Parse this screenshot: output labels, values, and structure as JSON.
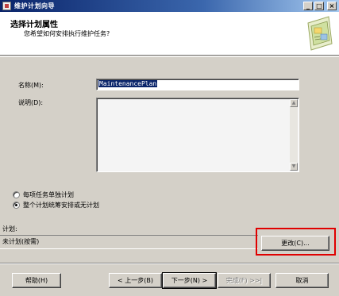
{
  "window": {
    "title": "维护计划向导"
  },
  "header": {
    "title": "选择计划属性",
    "subtitle": "您希望如何安排执行维护任务?"
  },
  "form": {
    "name_label": "名称(M):",
    "name_value": "MaintenancePlan",
    "desc_label": "说明(D):",
    "desc_value": ""
  },
  "options": [
    {
      "label": "每项任务单独计划",
      "checked": false
    },
    {
      "label": "整个计划统筹安排或无计划",
      "checked": true
    }
  ],
  "schedule": {
    "label": "计划:",
    "value": "未计划(按需)",
    "change_button": "更改(C)..."
  },
  "footer": {
    "help": "帮助(H)",
    "back": "< 上一步(B)",
    "next": "下一步(N) >",
    "finish": "完成(F) >>|",
    "cancel": "取消"
  }
}
